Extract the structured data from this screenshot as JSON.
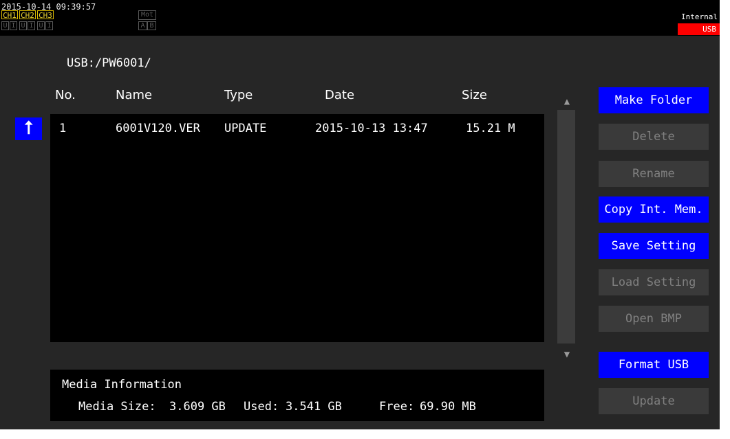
{
  "status": {
    "datetime": "2015-10-14 09:39:57",
    "channels": [
      "CH1",
      "CH2",
      "CH3"
    ],
    "ui_labels": [
      "U",
      "I",
      "U",
      "I",
      "U",
      "I"
    ],
    "motor_label": "Mot",
    "motor_ab": [
      "A",
      "B"
    ],
    "storage_internal": "Internal",
    "storage_usb": "USB"
  },
  "browser": {
    "path": "USB:/PW6001/",
    "columns": {
      "no": "No.",
      "name": "Name",
      "type": "Type",
      "date": "Date",
      "size": "Size"
    },
    "files": [
      {
        "no": "1",
        "name": "6001V120.VER",
        "type": "UPDATE",
        "date": "2015-10-13 13:47",
        "size": "15.21 M"
      }
    ],
    "up_icon": "up-folder-arrow-icon"
  },
  "buttons": {
    "make_folder": "Make Folder",
    "delete": "Delete",
    "rename": "Rename",
    "copy_int_mem": "Copy Int. Mem.",
    "save_setting": "Save Setting",
    "load_setting": "Load Setting",
    "open_bmp": "Open BMP",
    "format_usb": "Format USB",
    "update": "Update"
  },
  "media": {
    "title": "Media Information",
    "size_label": "Media Size:",
    "size_value": "3.609 GB",
    "used_label": "Used:",
    "used_value": "3.541 GB",
    "free_label": "Free:",
    "free_value": "69.90 MB"
  },
  "colors": {
    "button_active": "#0000ff",
    "button_disabled": "#3a3a3a",
    "usb_indicator": "#ff0000",
    "channel_label": "#e8d030"
  }
}
